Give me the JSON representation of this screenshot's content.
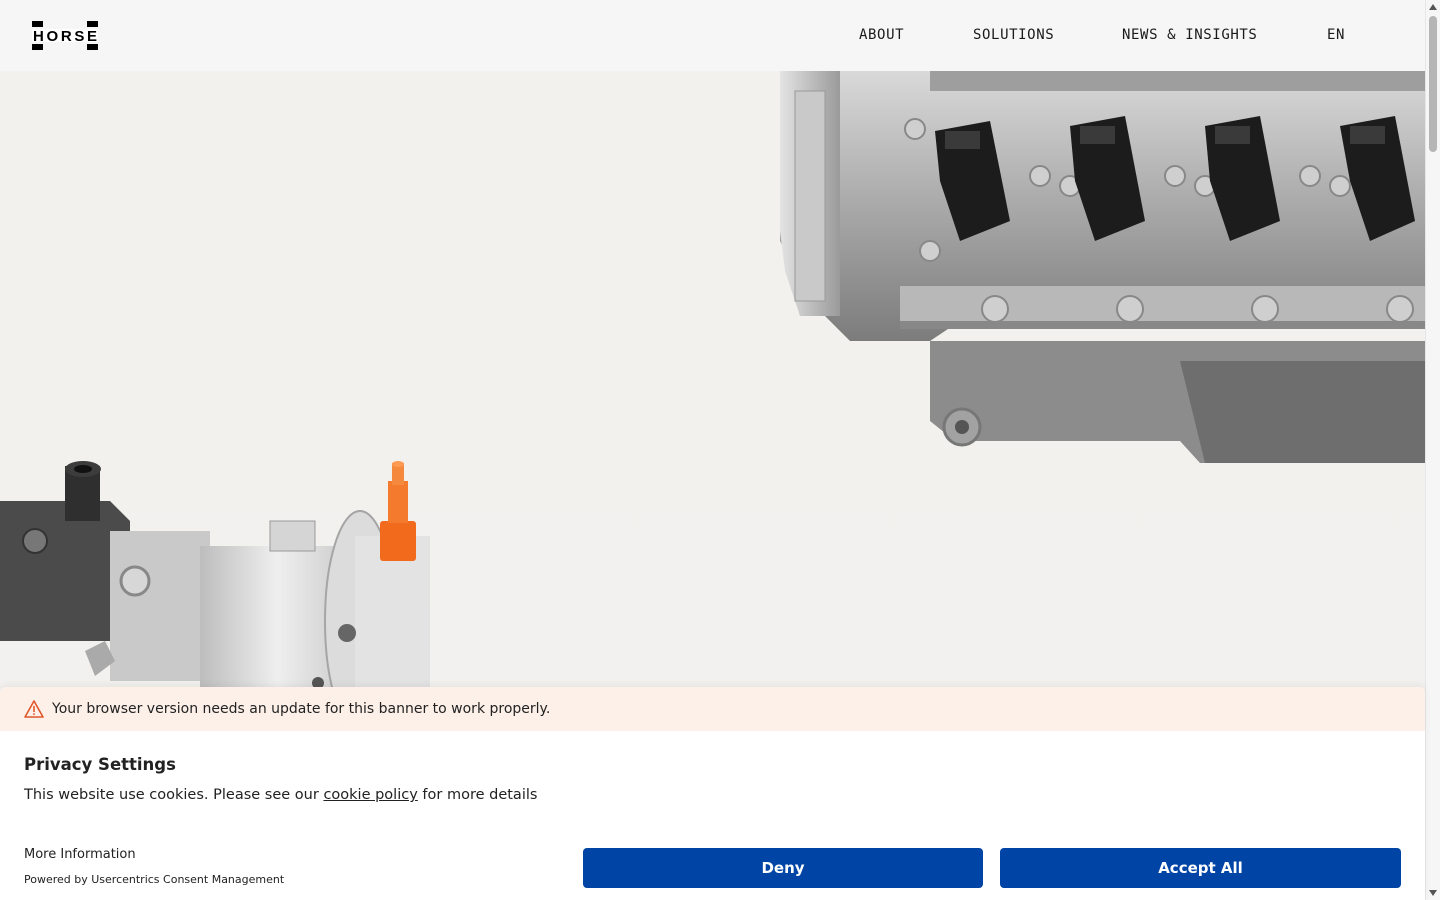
{
  "header": {
    "logo_alt": "HORSE",
    "nav": {
      "about": "ABOUT",
      "solutions": "SOLUTIONS",
      "news": "NEWS & INSIGHTS",
      "language": "EN"
    }
  },
  "banner": {
    "warning": "Your browser version needs an update for this banner to work properly.",
    "title": "Privacy Settings",
    "desc_before": "This website use cookies. Please see our ",
    "desc_link": "cookie policy",
    "desc_after": " for more details",
    "more_info": "More Information",
    "powered_by": "Powered by Usercentrics Consent Management",
    "deny": "Deny",
    "accept": "Accept All"
  },
  "colors": {
    "primary_button": "#0045a5",
    "warning_bg": "#fdf0e9",
    "warning_icon": "#e0572a",
    "accent_orange": "#f26a1b"
  },
  "icons": [
    "horse-logo",
    "warning-icon",
    "scroll-up-icon",
    "scroll-down-icon"
  ]
}
